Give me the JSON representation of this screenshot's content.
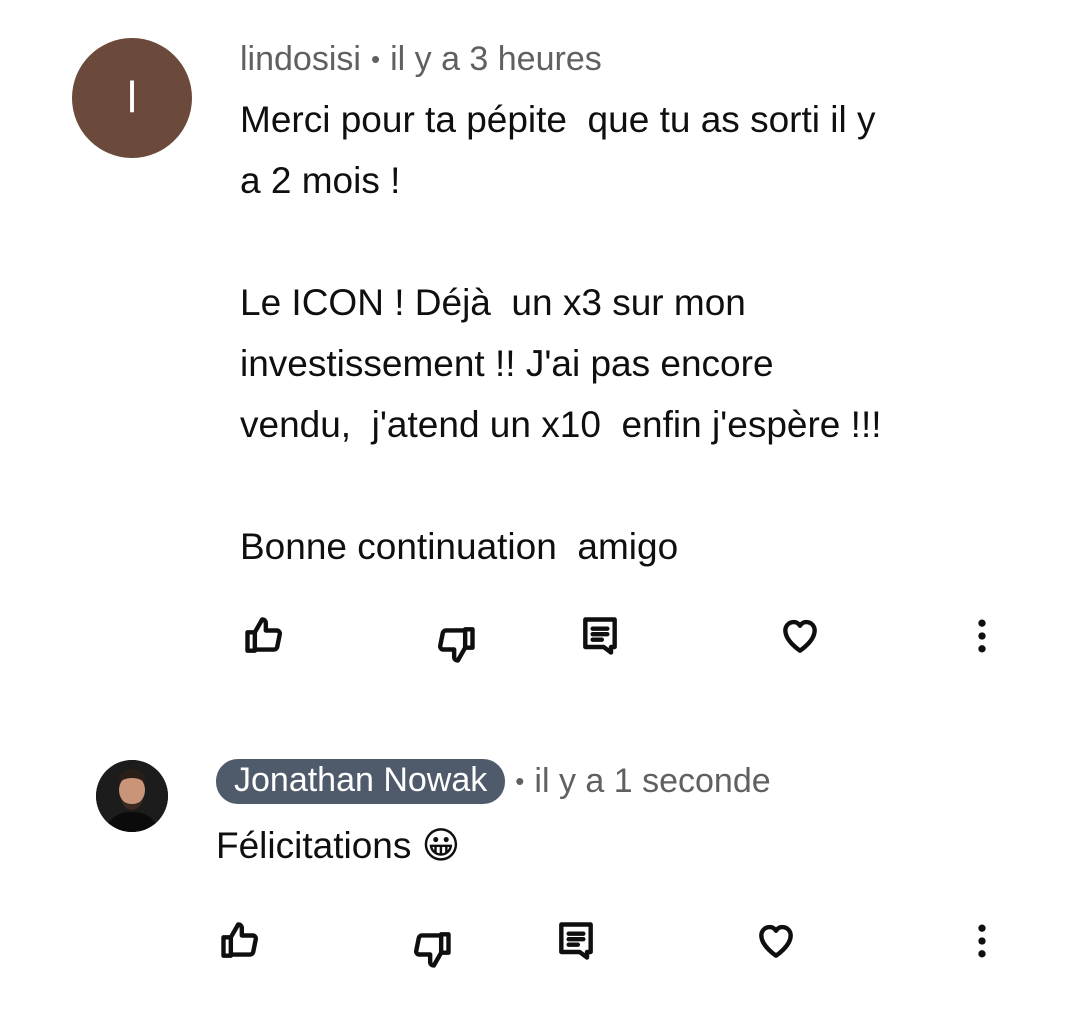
{
  "comments": [
    {
      "avatar_letter": "l",
      "avatar_color": "#6b4a3c",
      "author": "lindosisi",
      "separator": "•",
      "time": "il y a 3 heures",
      "text": "Merci pour ta pépite  que tu as sorti il y\na 2 mois !\n\nLe ICON ! Déjà  un x3 sur mon\ninvestissement !! J'ai pas encore\nvendu,  j'atend un x10  enfin j'espère !!!\n\nBonne continuation  amigo",
      "actions": {
        "like_icon": "thumbs-up-icon",
        "dislike_icon": "thumbs-down-icon",
        "reply_icon": "reply-icon",
        "heart_icon": "heart-icon",
        "more_icon": "more-vertical-icon"
      }
    },
    {
      "avatar_type": "photo",
      "author": "Jonathan Nowak",
      "author_badge_color": "#4f5b6b",
      "separator": "•",
      "time": "il y a 1 seconde",
      "text": "Félicitations 😀",
      "actions": {
        "like_icon": "thumbs-up-icon",
        "dislike_icon": "thumbs-down-icon",
        "reply_icon": "reply-icon",
        "heart_icon": "heart-icon",
        "more_icon": "more-vertical-icon"
      }
    }
  ]
}
